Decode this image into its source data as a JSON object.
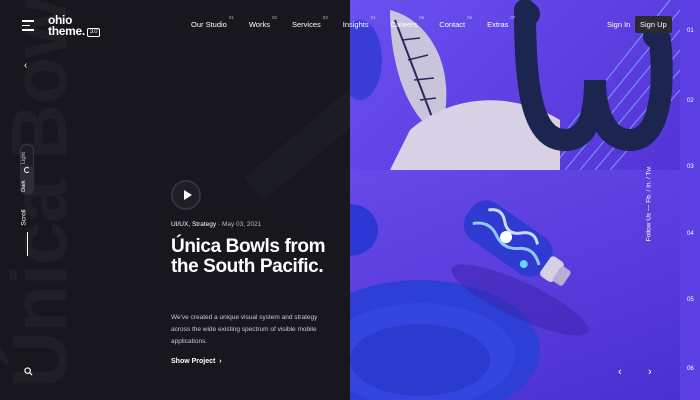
{
  "header": {
    "logo_line1": "ohio",
    "logo_line2": "theme.",
    "logo_version": "3.0",
    "nav": [
      {
        "label": "Our Studio",
        "num": "01"
      },
      {
        "label": "Works",
        "num": "02"
      },
      {
        "label": "Services",
        "num": "03"
      },
      {
        "label": "Insights",
        "num": "04"
      },
      {
        "label": "Careers",
        "num": "05"
      },
      {
        "label": "Contact",
        "num": "06"
      },
      {
        "label": "Extras",
        "num": "07"
      }
    ],
    "sign_in": "Sign In",
    "sign_up": "Sign Up"
  },
  "sidebar": {
    "mode_light": "Light",
    "mode_dark": "Dark",
    "scroll": "Scroll"
  },
  "background_text": "Única Bowls",
  "project": {
    "category": "UI/UX, Strategy",
    "date": "May 03, 2021",
    "title": "Única Bowls from the South Pacific.",
    "description": "We've created a unique visual system and strategy across the wide existing spectrum of visible mobile applications.",
    "link": "Show Project"
  },
  "slider": {
    "numbers": [
      "01",
      "02",
      "03",
      "04",
      "05",
      "06"
    ],
    "follow": "Follow Us — Fb. / In. / Tw."
  },
  "colors": {
    "dark": "#17171d",
    "accent_purple": "#5a3fe0",
    "navy": "#1a1f4a"
  },
  "icons": [
    "menu-icon",
    "chevron-left-icon",
    "moon-icon",
    "search-icon",
    "play-icon",
    "chevron-right-icon"
  ]
}
